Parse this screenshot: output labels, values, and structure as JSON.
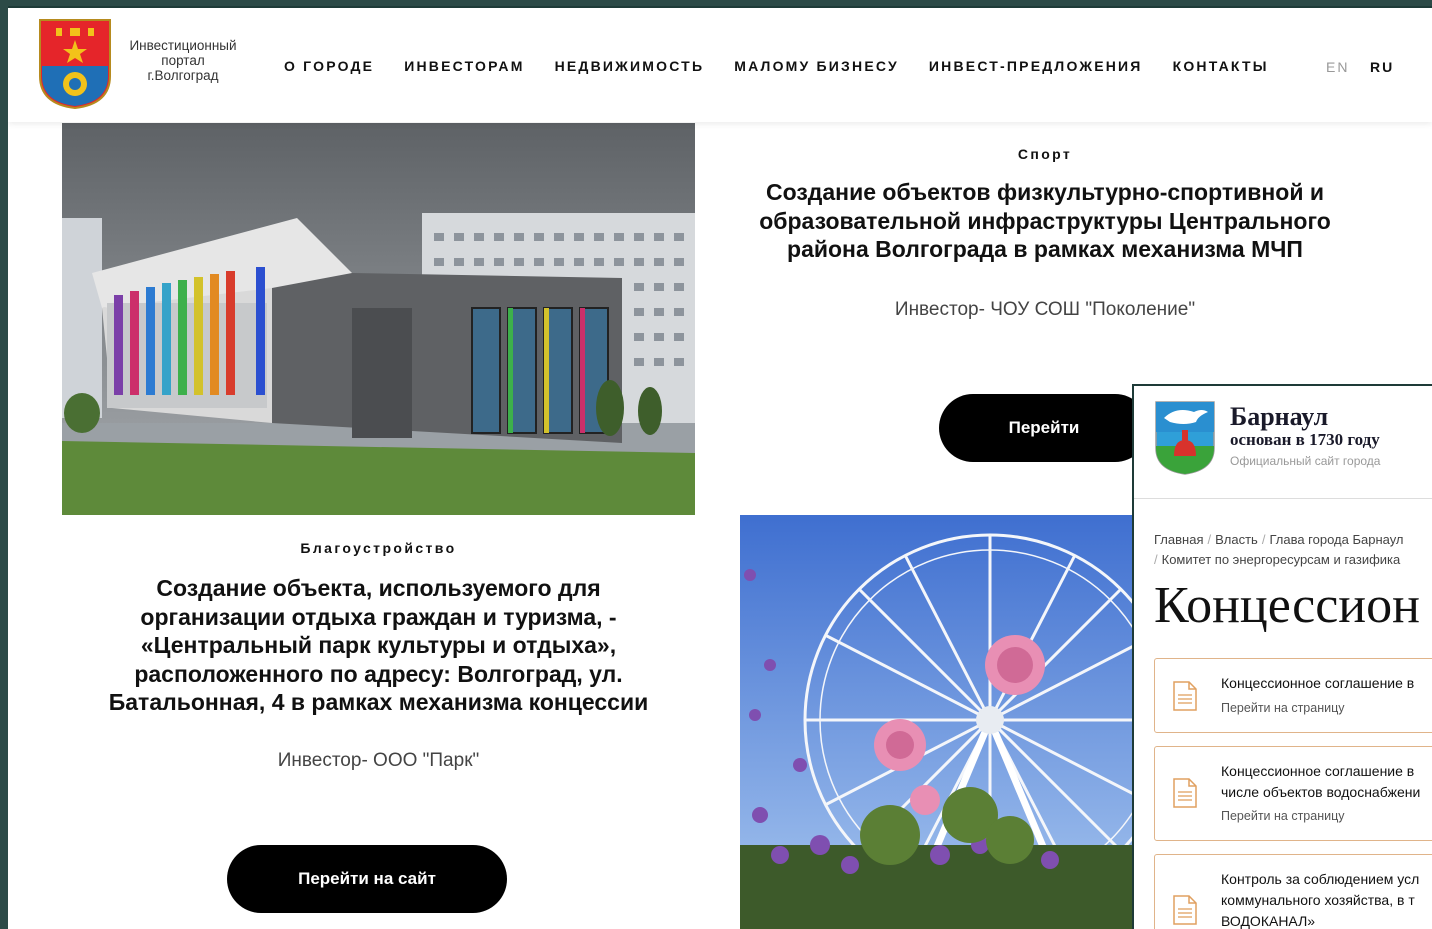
{
  "header": {
    "logo_lines": [
      "Инвестиционный",
      "портал",
      "г.Волгоград"
    ],
    "nav": [
      "О ГОРОДЕ",
      "ИНВЕСТОРАМ",
      "НЕДВИЖИМОСТЬ",
      "МАЛОМУ БИЗНЕСУ",
      "ИНВЕСТ-ПРЕДЛОЖЕНИЯ",
      "КОНТАКТЫ"
    ],
    "lang_en": "EN",
    "lang_ru": "RU"
  },
  "cards": {
    "sport": {
      "category": "Спорт",
      "title_lines": [
        "Создание объектов физкультурно-спортивной и",
        "образовательной инфраструктуры Центрального",
        "района Волгограда в рамках механизма МЧП"
      ],
      "investor": "Инвестор- ЧОУ СОШ \"Поколение\"",
      "button": "Перейти"
    },
    "park": {
      "category": "Благоустройство",
      "title_lines": [
        "Создание объекта, используемого для",
        "организации отдыха граждан и туризма, -",
        "«Центральный парк культуры и отдыха»,",
        "расположенного по адресу: Волгоград, ул.",
        "Батальонная, 4 в рамках механизма концессии"
      ],
      "investor": "Инвестор- ООО \"Парк\"",
      "button": "Перейти на сайт"
    }
  },
  "barnaul": {
    "city": "Барнаул",
    "founded": "основан в 1730 году",
    "official": "Официальный сайт города",
    "breadcrumbs": [
      "Главная",
      "Власть",
      "Глава города Барнаул",
      "Комитет по энергоресурсам и газифика"
    ],
    "heading": "Концессион",
    "items": [
      {
        "title_lines": [
          "Концессионное соглашение в"
        ],
        "link": "Перейти на страницу"
      },
      {
        "title_lines": [
          "Концессионное соглашение в",
          "числе объектов водоснабжени"
        ],
        "link": "Перейти на страницу"
      },
      {
        "title_lines": [
          "Контроль за соблюдением усл",
          "коммунального хозяйства, в т",
          "ВОДОКАНАЛ»"
        ],
        "link": ""
      }
    ]
  },
  "colors": {
    "button_bg": "#000000",
    "card_border": "#e0b48a",
    "frame": "#1e3b38"
  }
}
